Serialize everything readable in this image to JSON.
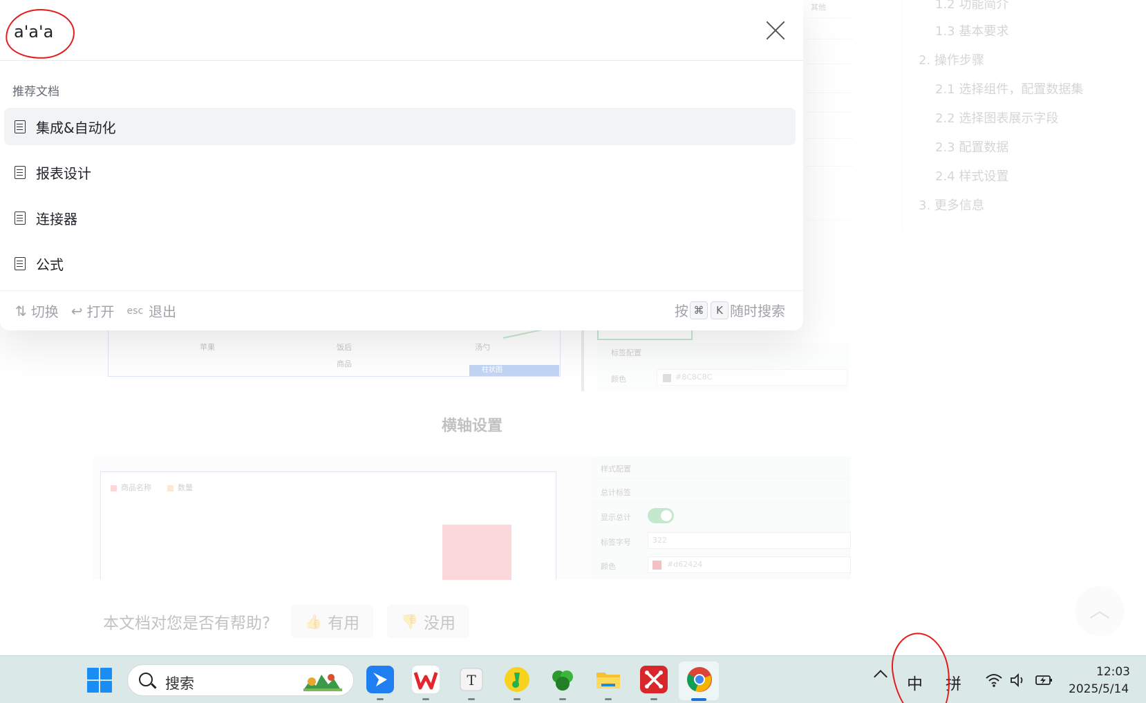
{
  "toc": {
    "items": [
      {
        "label": "1.2 功能简介",
        "level": 2
      },
      {
        "label": "1.3 基本要求",
        "level": 2
      },
      {
        "label": "2. 操作步骤",
        "level": 1
      },
      {
        "label": "2.1 选择组件，配置数据集",
        "level": 2
      },
      {
        "label": "2.2 选择图表展示字段",
        "level": 2
      },
      {
        "label": "2.3 配置数据",
        "level": 2
      },
      {
        "label": "2.4 样式设置",
        "level": 2
      },
      {
        "label": "3. 更多信息",
        "level": 1
      }
    ]
  },
  "doc": {
    "chart1": {
      "ticks": [
        "苹果",
        "饭后",
        "汤勺"
      ],
      "x_label": "商品",
      "bar_label": "柱状图",
      "panel_title": "标签配置",
      "color_label": "颜色",
      "color_value": "#8C8C8C",
      "top_label": "其他"
    },
    "section_title": "横轴设置",
    "chart2": {
      "legend": [
        "商品名称",
        "数量"
      ],
      "panel": {
        "style_config": "样式配置",
        "total_label": "总计标签",
        "show_total": "显示总计",
        "font_size_label": "标签字号",
        "font_size_value": "322",
        "color_label": "颜色",
        "color_value": "#d62424"
      }
    },
    "feedback": {
      "question": "本文档对您是否有帮助?",
      "useful": "有用",
      "useless": "没用"
    }
  },
  "search": {
    "query": "a'a'a",
    "section_label": "推荐文档",
    "results": [
      {
        "label": "集成&自动化",
        "active": true
      },
      {
        "label": "报表设计",
        "active": false
      },
      {
        "label": "连接器",
        "active": false
      },
      {
        "label": "公式",
        "active": false
      }
    ],
    "footer": {
      "switch_label": "切换",
      "open_label": "打开",
      "esc_key": "esc",
      "exit_label": "退出",
      "press_label": "按",
      "cmd_key": "⌘",
      "k_key": "K",
      "anytime_label": "随时搜索"
    }
  },
  "taskbar": {
    "search_placeholder": "搜索",
    "ime_mode": "中",
    "ime_type": "拼",
    "time": "12:03",
    "date": "2025/5/14",
    "apps": [
      "feishu-app",
      "wps-app",
      "typora-app",
      "qq-music-app",
      "clover-app",
      "file-explorer-app",
      "xmind-app",
      "chrome-app"
    ]
  },
  "colors": {
    "accent_blue": "#1a6fd8",
    "annotation_red": "#e31b1b",
    "taskbar_bg": "#dbe8e8"
  }
}
